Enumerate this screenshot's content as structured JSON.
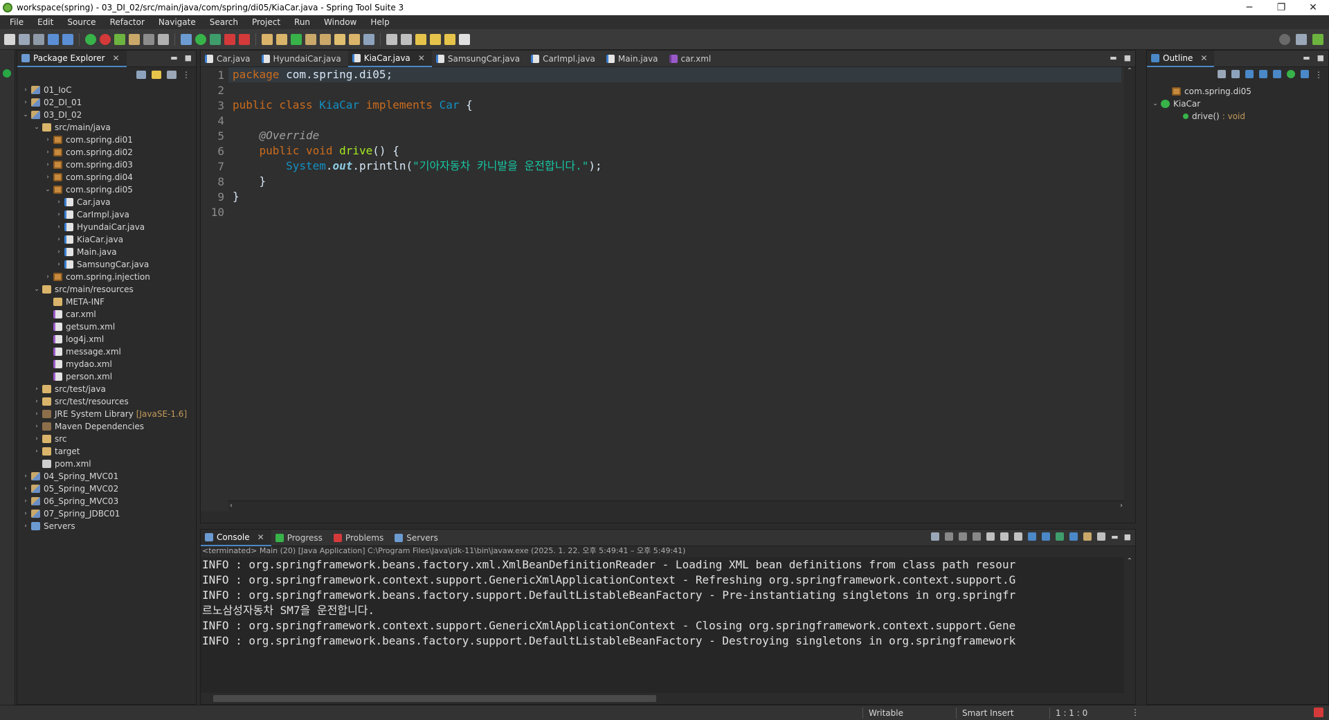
{
  "window": {
    "title": "workspace(spring) - 03_DI_02/src/main/java/com/spring/di05/KiaCar.java - Spring Tool Suite 3",
    "min_glyph": "─",
    "max_glyph": "❐",
    "close_glyph": "✕"
  },
  "menu": [
    "File",
    "Edit",
    "Source",
    "Refactor",
    "Navigate",
    "Search",
    "Project",
    "Run",
    "Window",
    "Help"
  ],
  "package_explorer": {
    "tab_label": "Package Explorer",
    "tree": [
      {
        "label": "01_IoC",
        "indent": 0,
        "arrow": "›",
        "icon": "proj"
      },
      {
        "label": "02_DI_01",
        "indent": 0,
        "arrow": "›",
        "icon": "proj"
      },
      {
        "label": "03_DI_02",
        "indent": 0,
        "arrow": "⌄",
        "icon": "proj"
      },
      {
        "label": "src/main/java",
        "indent": 1,
        "arrow": "⌄",
        "icon": "folder"
      },
      {
        "label": "com.spring.di01",
        "indent": 2,
        "arrow": "›",
        "icon": "pkg"
      },
      {
        "label": "com.spring.di02",
        "indent": 2,
        "arrow": "›",
        "icon": "pkg"
      },
      {
        "label": "com.spring.di03",
        "indent": 2,
        "arrow": "›",
        "icon": "pkg"
      },
      {
        "label": "com.spring.di04",
        "indent": 2,
        "arrow": "›",
        "icon": "pkg"
      },
      {
        "label": "com.spring.di05",
        "indent": 2,
        "arrow": "⌄",
        "icon": "pkg"
      },
      {
        "label": "Car.java",
        "indent": 3,
        "arrow": "›",
        "icon": "java"
      },
      {
        "label": "CarImpl.java",
        "indent": 3,
        "arrow": "›",
        "icon": "java"
      },
      {
        "label": "HyundaiCar.java",
        "indent": 3,
        "arrow": "›",
        "icon": "java"
      },
      {
        "label": "KiaCar.java",
        "indent": 3,
        "arrow": "›",
        "icon": "java"
      },
      {
        "label": "Main.java",
        "indent": 3,
        "arrow": "›",
        "icon": "java"
      },
      {
        "label": "SamsungCar.java",
        "indent": 3,
        "arrow": "›",
        "icon": "java"
      },
      {
        "label": "com.spring.injection",
        "indent": 2,
        "arrow": "›",
        "icon": "pkg"
      },
      {
        "label": "src/main/resources",
        "indent": 1,
        "arrow": "⌄",
        "icon": "folder"
      },
      {
        "label": "META-INF",
        "indent": 2,
        "arrow": "",
        "icon": "folder"
      },
      {
        "label": "car.xml",
        "indent": 2,
        "arrow": "",
        "icon": "xml"
      },
      {
        "label": "getsum.xml",
        "indent": 2,
        "arrow": "",
        "icon": "xml"
      },
      {
        "label": "log4j.xml",
        "indent": 2,
        "arrow": "",
        "icon": "xml"
      },
      {
        "label": "message.xml",
        "indent": 2,
        "arrow": "",
        "icon": "xml"
      },
      {
        "label": "mydao.xml",
        "indent": 2,
        "arrow": "",
        "icon": "xml"
      },
      {
        "label": "person.xml",
        "indent": 2,
        "arrow": "",
        "icon": "xml"
      },
      {
        "label": "src/test/java",
        "indent": 1,
        "arrow": "›",
        "icon": "folder"
      },
      {
        "label": "src/test/resources",
        "indent": 1,
        "arrow": "›",
        "icon": "folder"
      },
      {
        "label": "JRE System Library",
        "indent": 1,
        "arrow": "›",
        "icon": "lib",
        "extra": "[JavaSE-1.6]"
      },
      {
        "label": "Maven Dependencies",
        "indent": 1,
        "arrow": "›",
        "icon": "lib"
      },
      {
        "label": "src",
        "indent": 1,
        "arrow": "›",
        "icon": "folder"
      },
      {
        "label": "target",
        "indent": 1,
        "arrow": "›",
        "icon": "folder"
      },
      {
        "label": "pom.xml",
        "indent": 1,
        "arrow": "",
        "icon": "file"
      },
      {
        "label": "04_Spring_MVC01",
        "indent": 0,
        "arrow": "›",
        "icon": "proj"
      },
      {
        "label": "05_Spring_MVC02",
        "indent": 0,
        "arrow": "›",
        "icon": "proj"
      },
      {
        "label": "06_Spring_MVC03",
        "indent": 0,
        "arrow": "›",
        "icon": "proj"
      },
      {
        "label": "07_Spring_JDBC01",
        "indent": 0,
        "arrow": "›",
        "icon": "proj"
      },
      {
        "label": "Servers",
        "indent": 0,
        "arrow": "›",
        "icon": "server"
      }
    ]
  },
  "editor": {
    "tabs": [
      {
        "label": "Car.java",
        "active": false
      },
      {
        "label": "HyundaiCar.java",
        "active": false
      },
      {
        "label": "KiaCar.java",
        "active": true
      },
      {
        "label": "SamsungCar.java",
        "active": false
      },
      {
        "label": "CarImpl.java",
        "active": false
      },
      {
        "label": "Main.java",
        "active": false
      },
      {
        "label": "car.xml",
        "active": false
      }
    ],
    "line_numbers": [
      "1",
      "2",
      "3",
      "4",
      "5",
      "6",
      "7",
      "8",
      "9",
      "10"
    ],
    "code": {
      "l1_kw": "package",
      "l1_rest": " com.spring.di05;",
      "l3_kw1": "public class ",
      "l3_cls": "KiaCar",
      "l3_kw2": " implements ",
      "l3_iface": "Car",
      "l3_rest": " {",
      "l5_ann": "    @Override",
      "l6_kw": "    public void ",
      "l6_meth": "drive",
      "l6_rest": "() {",
      "l7_cls": "        System",
      "l7_dot": ".",
      "l7_field": "out",
      "l7_call": ".println(",
      "l7_str": "\"기아자동차 카니발을 운전합니다.\"",
      "l7_end": ");",
      "l8": "    }",
      "l9": "}"
    }
  },
  "console": {
    "tabs": [
      "Console",
      "Progress",
      "Problems",
      "Servers"
    ],
    "status": "<terminated> Main (20) [Java Application] C:\\Program Files\\Java\\jdk-11\\bin\\javaw.exe  (2025. 1. 22. 오후 5:49:41 – 오후 5:49:41)",
    "lines": [
      "INFO : org.springframework.beans.factory.xml.XmlBeanDefinitionReader - Loading XML bean definitions from class path resour",
      "INFO : org.springframework.context.support.GenericXmlApplicationContext - Refreshing org.springframework.context.support.G",
      "INFO : org.springframework.beans.factory.support.DefaultListableBeanFactory - Pre-instantiating singletons in org.springfr",
      "르노삼성자동차 SM7을 운전합니다.",
      "INFO : org.springframework.context.support.GenericXmlApplicationContext - Closing org.springframework.context.support.Gene",
      "INFO : org.springframework.beans.factory.support.DefaultListableBeanFactory - Destroying singletons in org.springframework"
    ]
  },
  "outline": {
    "tab_label": "Outline",
    "items": [
      {
        "label": "com.spring.di05",
        "indent": 1,
        "arrow": "",
        "icon": "pkg"
      },
      {
        "label": "KiaCar",
        "indent": 0,
        "arrow": "⌄",
        "icon": "cls"
      },
      {
        "label": "drive()",
        "indent": 2,
        "arrow": "",
        "icon": "meth",
        "extra": ": void"
      }
    ]
  },
  "statusbar": {
    "writable": "Writable",
    "insert_mode": "Smart Insert",
    "position": "1 : 1 : 0"
  }
}
